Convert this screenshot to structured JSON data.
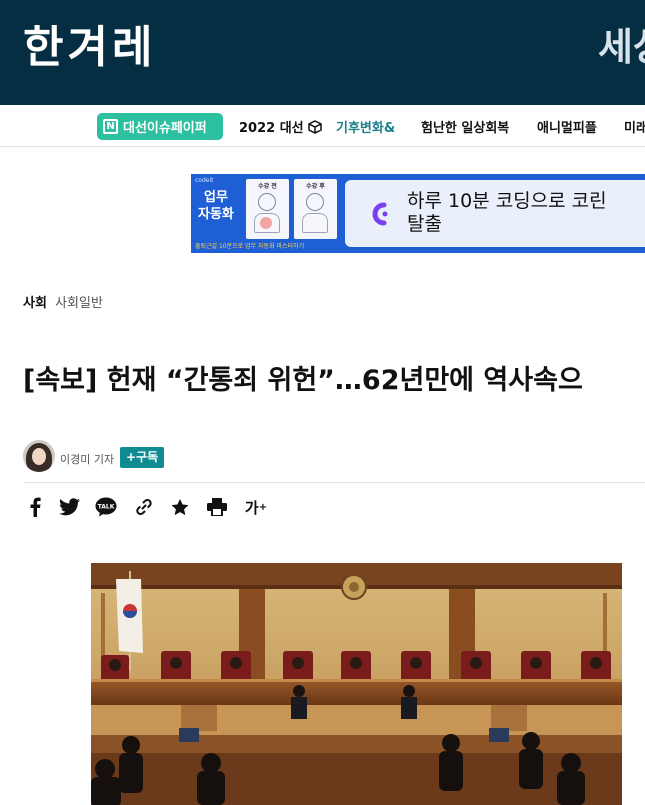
{
  "header": {
    "logo": "한겨레",
    "right_text": "세상"
  },
  "nav": {
    "badge_label": "대선이슈페이퍼",
    "badge_icon": "N",
    "items": [
      {
        "label": "2022 대선",
        "icon": "cube-icon"
      },
      {
        "label": "기후변화&"
      },
      {
        "label": "험난한 일상회복"
      },
      {
        "label": "애니멀피플"
      },
      {
        "label": "미래"
      }
    ]
  },
  "ad": {
    "tiny_label": "codeit",
    "title_line1": "업무",
    "title_line2": "자동화",
    "card1_caption": "수강 전",
    "card2_caption": "수강 후",
    "footer_text": "출퇴근길 10분으로 업무 자동화 마스터하기",
    "headline_line1": "하루 10분 코딩으로 코린",
    "headline_line2": "탈출",
    "accent_color": "#7b3ff2"
  },
  "article": {
    "category_main": "사회",
    "category_sub": "사회일반",
    "headline": "[속보] 헌재 “간통죄 위헌”…62년만에 역사속으",
    "reporter": "이경미 기자",
    "subscribe_label": "+구독",
    "font_size_label": "가"
  },
  "share_icons": [
    "facebook-icon",
    "twitter-icon",
    "kakaotalk-icon",
    "link-icon",
    "star-icon",
    "print-icon",
    "font-size-icon"
  ],
  "colors": {
    "header_bg": "#062e43",
    "badge_bg": "#2cc0a0",
    "subscribe_bg": "#108b91",
    "ad_bg": "#1f5fd6"
  }
}
